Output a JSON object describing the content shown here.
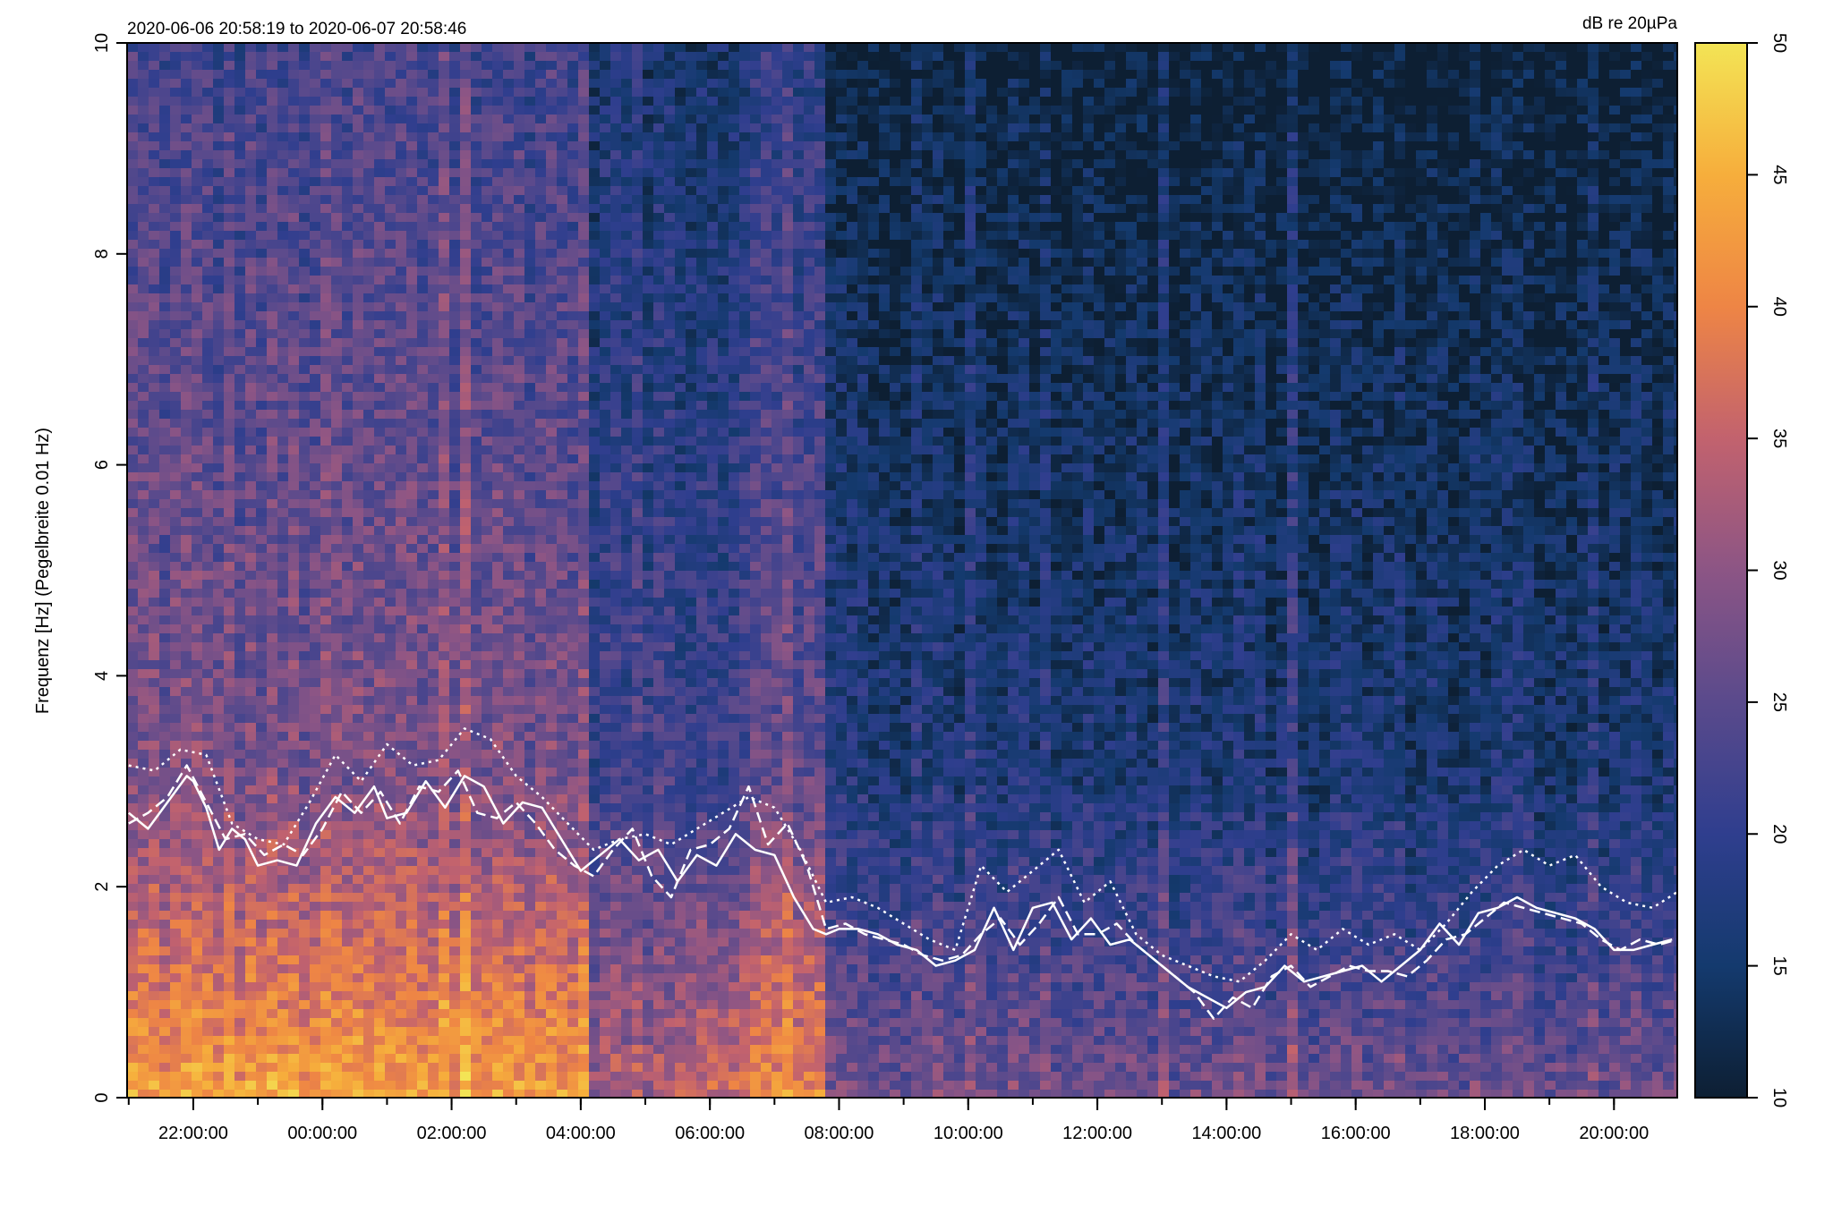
{
  "chart_data": {
    "type": "heatmap",
    "subtitle": "2020-06-06 20:58:19 to 2020-06-07 20:58:46",
    "ylabel": "Frequenz [Hz] (Pegelbreite 0.01 Hz)",
    "xlabel": "",
    "x_range_hours": [
      20.975,
      44.98
    ],
    "ylim": [
      0,
      10
    ],
    "y_ticks": [
      "0",
      "2",
      "4",
      "6",
      "8",
      "10"
    ],
    "x_ticks": [
      {
        "hour": 22,
        "label": "22:00:00"
      },
      {
        "hour": 24,
        "label": "00:00:00"
      },
      {
        "hour": 26,
        "label": "02:00:00"
      },
      {
        "hour": 28,
        "label": "04:00:00"
      },
      {
        "hour": 30,
        "label": "06:00:00"
      },
      {
        "hour": 32,
        "label": "08:00:00"
      },
      {
        "hour": 34,
        "label": "10:00:00"
      },
      {
        "hour": 36,
        "label": "12:00:00"
      },
      {
        "hour": 38,
        "label": "14:00:00"
      },
      {
        "hour": 40,
        "label": "16:00:00"
      },
      {
        "hour": 42,
        "label": "18:00:00"
      },
      {
        "hour": 44,
        "label": "20:00:00"
      }
    ],
    "colorbar": {
      "label": "dB re 20µPa",
      "range": [
        10,
        50
      ],
      "ticks": [
        "10",
        "15",
        "20",
        "25",
        "30",
        "35",
        "40",
        "45",
        "50"
      ],
      "colors": [
        "#0d1f33",
        "#143a6e",
        "#2f3e8e",
        "#5a4a8c",
        "#8c5585",
        "#c2626e",
        "#ee8545",
        "#f6ae3c",
        "#f3e455"
      ]
    },
    "series": [
      {
        "style": "solid",
        "color": "#ffffff",
        "x_hours": [
          21.0,
          21.3,
          21.6,
          21.9,
          22.0,
          22.2,
          22.4,
          22.6,
          22.8,
          23.0,
          23.3,
          23.6,
          23.9,
          24.2,
          24.5,
          24.8,
          25.0,
          25.3,
          25.6,
          25.9,
          26.2,
          26.5,
          26.8,
          27.1,
          27.4,
          27.7,
          28.0,
          28.3,
          28.6,
          28.9,
          29.2,
          29.5,
          29.8,
          30.1,
          30.4,
          30.7,
          31.0,
          31.3,
          31.6,
          31.8,
          32.0,
          32.3,
          32.6,
          32.9,
          33.2,
          33.5,
          33.8,
          34.1,
          34.4,
          34.7,
          35.0,
          35.3,
          35.6,
          35.9,
          36.2,
          36.5,
          36.8,
          37.1,
          37.4,
          37.7,
          38.0,
          38.3,
          38.6,
          38.9,
          39.2,
          39.5,
          39.8,
          40.1,
          40.4,
          40.7,
          41.0,
          41.3,
          41.6,
          41.9,
          42.2,
          42.5,
          42.8,
          43.1,
          43.4,
          43.7,
          44.0,
          44.3,
          44.6,
          44.9
        ],
        "y_hz": [
          2.7,
          2.55,
          2.8,
          3.05,
          3.0,
          2.75,
          2.35,
          2.55,
          2.45,
          2.2,
          2.25,
          2.2,
          2.6,
          2.85,
          2.7,
          2.95,
          2.65,
          2.7,
          3.0,
          2.75,
          3.05,
          2.95,
          2.6,
          2.8,
          2.75,
          2.45,
          2.15,
          2.3,
          2.45,
          2.25,
          2.35,
          2.05,
          2.3,
          2.2,
          2.5,
          2.35,
          2.3,
          1.9,
          1.6,
          1.55,
          1.6,
          1.6,
          1.55,
          1.45,
          1.4,
          1.25,
          1.3,
          1.4,
          1.8,
          1.4,
          1.8,
          1.85,
          1.5,
          1.7,
          1.45,
          1.5,
          1.35,
          1.2,
          1.05,
          0.95,
          0.85,
          1.0,
          1.05,
          1.25,
          1.1,
          1.15,
          1.2,
          1.25,
          1.1,
          1.25,
          1.4,
          1.65,
          1.45,
          1.75,
          1.8,
          1.9,
          1.8,
          1.75,
          1.7,
          1.6,
          1.4,
          1.4,
          1.45,
          1.5
        ]
      },
      {
        "style": "dashed",
        "color": "#ffffff",
        "x_hours": [
          21.0,
          21.3,
          21.6,
          21.9,
          22.2,
          22.5,
          22.8,
          23.1,
          23.4,
          23.7,
          24.0,
          24.3,
          24.6,
          24.9,
          25.2,
          25.5,
          25.8,
          26.1,
          26.4,
          26.7,
          27.0,
          27.3,
          27.6,
          27.9,
          28.2,
          28.5,
          28.8,
          29.1,
          29.4,
          29.7,
          30.0,
          30.3,
          30.6,
          30.9,
          31.2,
          31.5,
          31.8,
          32.1,
          32.4,
          32.7,
          33.0,
          33.3,
          33.6,
          33.9,
          34.2,
          34.5,
          34.8,
          35.1,
          35.4,
          35.7,
          36.0,
          36.3,
          36.6,
          36.9,
          37.2,
          37.5,
          37.8,
          38.1,
          38.4,
          38.7,
          39.0,
          39.3,
          39.6,
          39.9,
          40.2,
          40.5,
          40.8,
          41.1,
          41.4,
          41.7,
          42.0,
          42.3,
          42.6,
          42.9,
          43.2,
          43.5,
          43.8,
          44.1,
          44.4,
          44.7,
          44.98
        ],
        "y_hz": [
          2.6,
          2.7,
          2.85,
          3.15,
          2.8,
          2.45,
          2.5,
          2.3,
          2.4,
          2.3,
          2.55,
          2.9,
          2.7,
          2.9,
          2.6,
          2.95,
          2.9,
          3.1,
          2.7,
          2.65,
          2.8,
          2.6,
          2.35,
          2.2,
          2.1,
          2.35,
          2.55,
          2.1,
          1.9,
          2.35,
          2.4,
          2.55,
          2.95,
          2.4,
          2.6,
          2.2,
          1.6,
          1.65,
          1.55,
          1.5,
          1.45,
          1.35,
          1.3,
          1.35,
          1.55,
          1.7,
          1.45,
          1.65,
          1.9,
          1.55,
          1.55,
          1.65,
          1.45,
          1.3,
          1.15,
          1.0,
          0.75,
          0.95,
          0.85,
          1.15,
          1.25,
          1.05,
          1.15,
          1.25,
          1.2,
          1.2,
          1.15,
          1.3,
          1.5,
          1.55,
          1.7,
          1.85,
          1.8,
          1.75,
          1.7,
          1.65,
          1.5,
          1.4,
          1.5,
          1.45,
          1.5
        ]
      },
      {
        "style": "dotted",
        "color": "#ffffff",
        "x_hours": [
          21.0,
          21.4,
          21.8,
          22.2,
          22.6,
          23.0,
          23.4,
          23.8,
          24.2,
          24.6,
          25.0,
          25.4,
          25.8,
          26.2,
          26.6,
          27.0,
          27.4,
          27.8,
          28.2,
          28.6,
          29.0,
          29.4,
          29.8,
          30.2,
          30.6,
          31.0,
          31.4,
          31.8,
          32.2,
          32.6,
          33.0,
          33.4,
          33.8,
          34.2,
          34.6,
          35.0,
          35.4,
          35.8,
          36.2,
          36.6,
          37.0,
          37.4,
          37.8,
          38.2,
          38.6,
          39.0,
          39.4,
          39.8,
          40.2,
          40.6,
          41.0,
          41.4,
          41.8,
          42.2,
          42.6,
          43.0,
          43.4,
          43.8,
          44.2,
          44.6,
          44.98
        ],
        "y_hz": [
          3.15,
          3.1,
          3.3,
          3.25,
          2.6,
          2.45,
          2.4,
          2.8,
          3.25,
          3.0,
          3.35,
          3.15,
          3.2,
          3.5,
          3.4,
          3.05,
          2.85,
          2.6,
          2.35,
          2.45,
          2.5,
          2.4,
          2.55,
          2.7,
          2.85,
          2.75,
          2.35,
          1.85,
          1.9,
          1.8,
          1.65,
          1.5,
          1.4,
          2.2,
          1.95,
          2.15,
          2.35,
          1.85,
          2.05,
          1.55,
          1.35,
          1.25,
          1.15,
          1.1,
          1.3,
          1.55,
          1.4,
          1.6,
          1.45,
          1.55,
          1.4,
          1.65,
          1.95,
          2.2,
          2.35,
          2.2,
          2.3,
          2.0,
          1.85,
          1.8,
          1.95
        ]
      }
    ]
  }
}
